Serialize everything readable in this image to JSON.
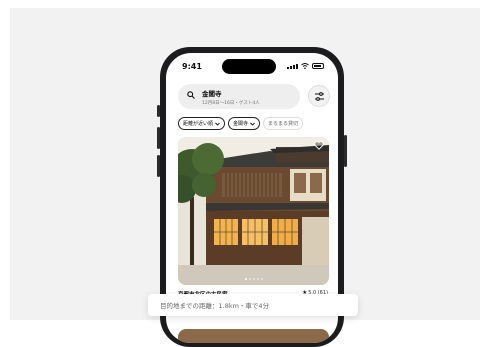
{
  "status_bar": {
    "time": "9:41"
  },
  "search": {
    "title": "金閣寺",
    "subtitle": "12月8日～16日・ゲスト4人"
  },
  "filters": [
    {
      "label": "距離が近い順",
      "has_dropdown": true,
      "selected": true
    },
    {
      "label": "金閣寺",
      "has_dropdown": true,
      "selected": true
    },
    {
      "label": "まるまる貸切",
      "has_dropdown": false,
      "selected": false
    }
  ],
  "listing": {
    "title": "京都市北区の古民家",
    "rating": "5.0 (61)",
    "photo_count": 5,
    "active_photo_index": 0,
    "favorited": false
  },
  "tooltip": {
    "text": "目的地までの距離：1.8km・車で4分"
  },
  "colors": {
    "accent": "#111111",
    "background": "#f2f2f2",
    "next_card": "#8b6a4a"
  }
}
